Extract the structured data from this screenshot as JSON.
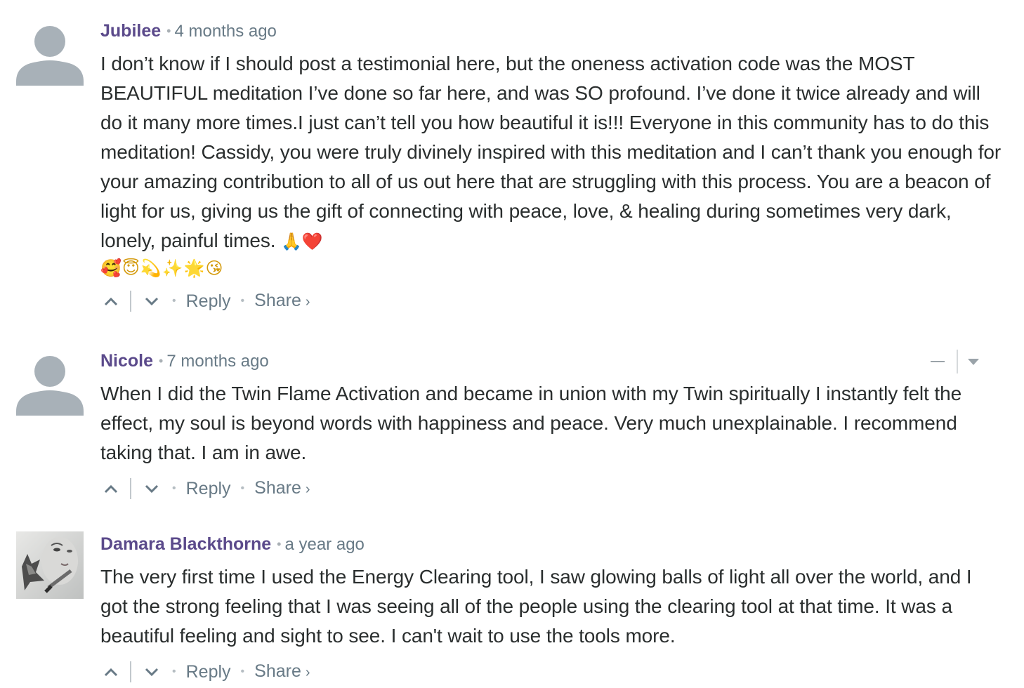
{
  "comments": [
    {
      "author": "Jubilee",
      "time": "4 months ago",
      "body": "I don’t know if I should post a testimonial here, but the oneness activation code was the MOST BEAUTIFUL meditation I’ve done so far here, and was SO profound. I’ve done it twice already and will do it many more times.I just can’t tell you how beautiful it is!!! Everyone in this community has to do this meditation! Cassidy, you were truly divinely inspired with this meditation and I can’t thank you enough for your amazing contribution to all of us out here that are struggling with this process. You are a beacon of light for us, giving us the gift of connecting with peace, love, & healing during sometimes very dark, lonely, painful times.",
      "inline_emoji": "🙏❤️",
      "emoji_row": "🥰😇💫✨🌟😘",
      "reply": "Reply",
      "share": "Share",
      "share_chevron": "›",
      "avatar": "default-avatar"
    },
    {
      "author": "Nicole",
      "time": "7 months ago",
      "body": "When I did the Twin Flame Activation and became in union with my Twin spiritually I instantly felt the effect, my soul is beyond words with happiness and peace. Very much unexplainable. I recommend taking that. I am in awe.",
      "reply": "Reply",
      "share": "Share",
      "share_chevron": "›",
      "avatar": "default-avatar"
    },
    {
      "author": "Damara Blackthorne",
      "time": "a year ago",
      "body": "The very first time I used the Energy Clearing tool, I saw glowing balls of light all over the world, and I got the strong feeling that I was seeing all of the people using the clearing tool at that time. It was a beautiful feeling and sight to see. I can't wait to use the tools more.",
      "reply": "Reply",
      "share": "Share",
      "share_chevron": "›",
      "avatar": "photo-avatar"
    }
  ],
  "separator": "•",
  "colors": {
    "author": "#5b4a8b",
    "meta": "#687a86",
    "body": "#2a2e2e",
    "avatar_gray": "#a8b1b8"
  }
}
